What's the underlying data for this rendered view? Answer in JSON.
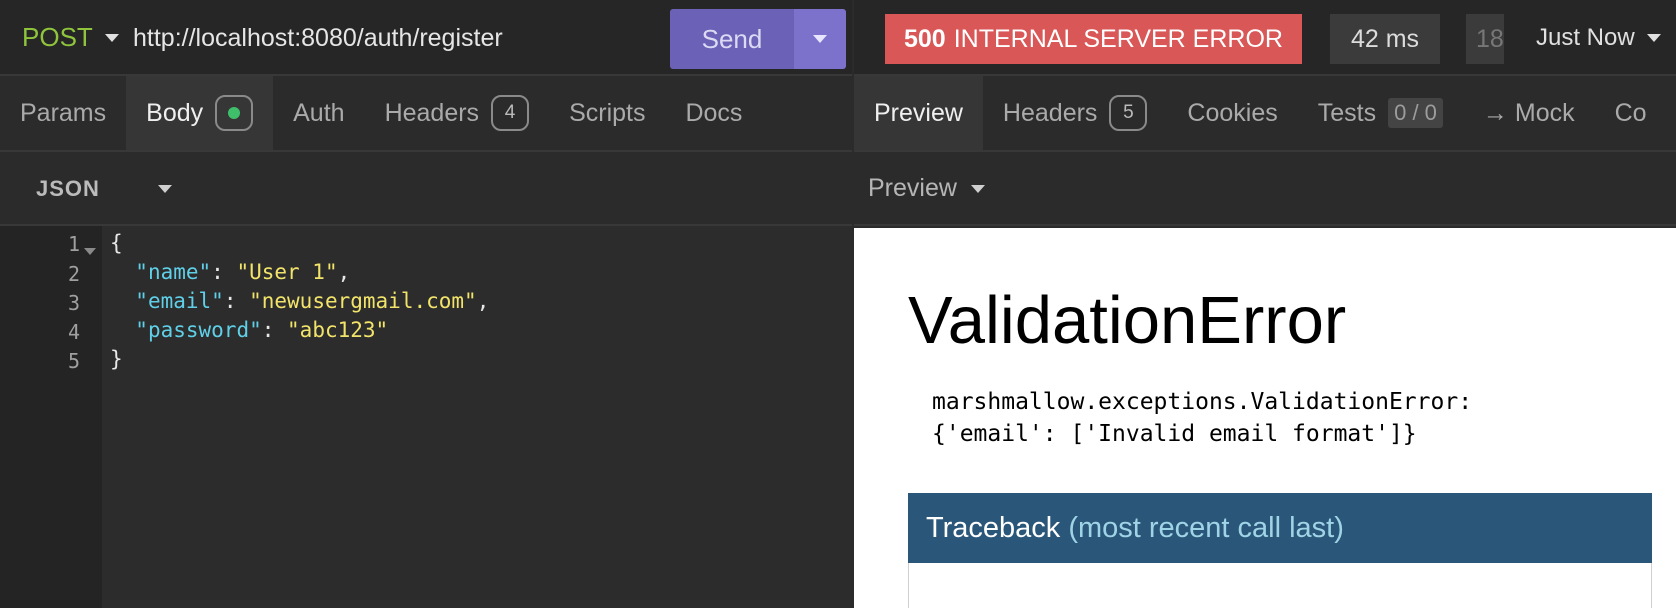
{
  "request": {
    "method": "POST",
    "url": "http://localhost:8080/auth/register",
    "send_label": "Send"
  },
  "request_tabs": [
    {
      "label": "Params"
    },
    {
      "label": "Body"
    },
    {
      "label": "Auth"
    },
    {
      "label": "Headers",
      "badge": "4"
    },
    {
      "label": "Scripts"
    },
    {
      "label": "Docs"
    }
  ],
  "body_type": "JSON",
  "editor": {
    "line_numbers": [
      "1",
      "2",
      "3",
      "4",
      "5"
    ],
    "open_brace": "{",
    "close_brace": "}",
    "fields": [
      {
        "key": "\"name\"",
        "value": "\"User 1\"",
        "comma": ","
      },
      {
        "key": "\"email\"",
        "value": "\"newusergmail.com\"",
        "comma": ","
      },
      {
        "key": "\"password\"",
        "value": "\"abc123\"",
        "comma": ""
      }
    ]
  },
  "response": {
    "status_code": "500",
    "status_text": "INTERNAL SERVER ERROR",
    "time": "42 ms",
    "size_partial": "18",
    "timestamp": "Just Now",
    "status_color": "#d95757"
  },
  "response_tabs": [
    {
      "label": "Preview"
    },
    {
      "label": "Headers",
      "badge": "5"
    },
    {
      "label": "Cookies"
    },
    {
      "label": "Tests",
      "badge": "0 / 0"
    },
    {
      "label": "→ Mock"
    },
    {
      "label": "Co"
    }
  ],
  "preview_mode": "Preview",
  "preview": {
    "title": "ValidationError",
    "message": "marshmallow.exceptions.ValidationError:\n{'email': ['Invalid email format']}",
    "traceback_title": "Traceback",
    "traceback_sub": "(most recent call last)"
  },
  "colors": {
    "accent": "#6b62b8",
    "method": "#8fc43c",
    "json_key": "#5fd0e8",
    "json_string": "#f2e46a",
    "traceback_header": "#2a5679"
  }
}
